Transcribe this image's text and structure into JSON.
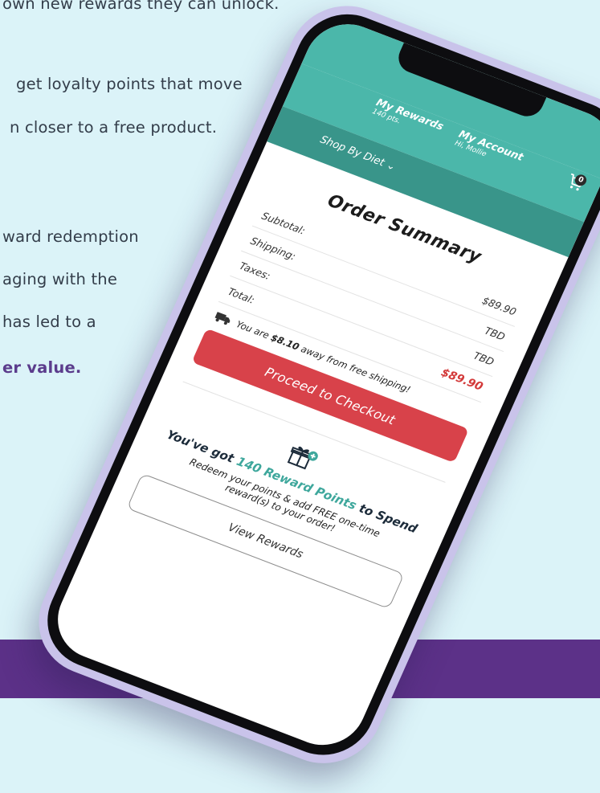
{
  "copy": {
    "line1": "own new rewards they can unlock.",
    "line2": "get loyalty points that move",
    "line3": "n closer to a free product.",
    "line4": "ward redemption",
    "line5": "aging with the",
    "line6": "has led to a",
    "line7": "er value."
  },
  "header": {
    "rewards_title": "My Rewards",
    "rewards_points": "140 pts.",
    "account_title": "My Account",
    "account_greeting": "Hi, Mollie",
    "cart_count": "0",
    "shop_by_diet": "Shop By Diet"
  },
  "order": {
    "title": "Order Summary",
    "rows": [
      {
        "label": "Subtotal:",
        "value": "$89.90"
      },
      {
        "label": "Shipping:",
        "value": "TBD"
      },
      {
        "label": "Taxes:",
        "value": "TBD"
      },
      {
        "label": "Total:",
        "value": "$89.90"
      }
    ],
    "ship_prefix": "You are",
    "ship_amount": "$8.10",
    "ship_suffix": "away from free shipping!",
    "checkout_label": "Proceed to Checkout"
  },
  "rewards": {
    "head_prefix": "You've got",
    "head_points": "140 Reward Points",
    "head_suffix": "to Spend",
    "subtext": "Redeem your points & add FREE one-time reward(s) to your order!",
    "button_label": "View Rewards"
  },
  "colors": {
    "teal": "#4bb7aa",
    "teal_dark": "#39958a",
    "red": "#d8424a",
    "purple_band": "#5c3188",
    "background": "#dbf3f8"
  }
}
